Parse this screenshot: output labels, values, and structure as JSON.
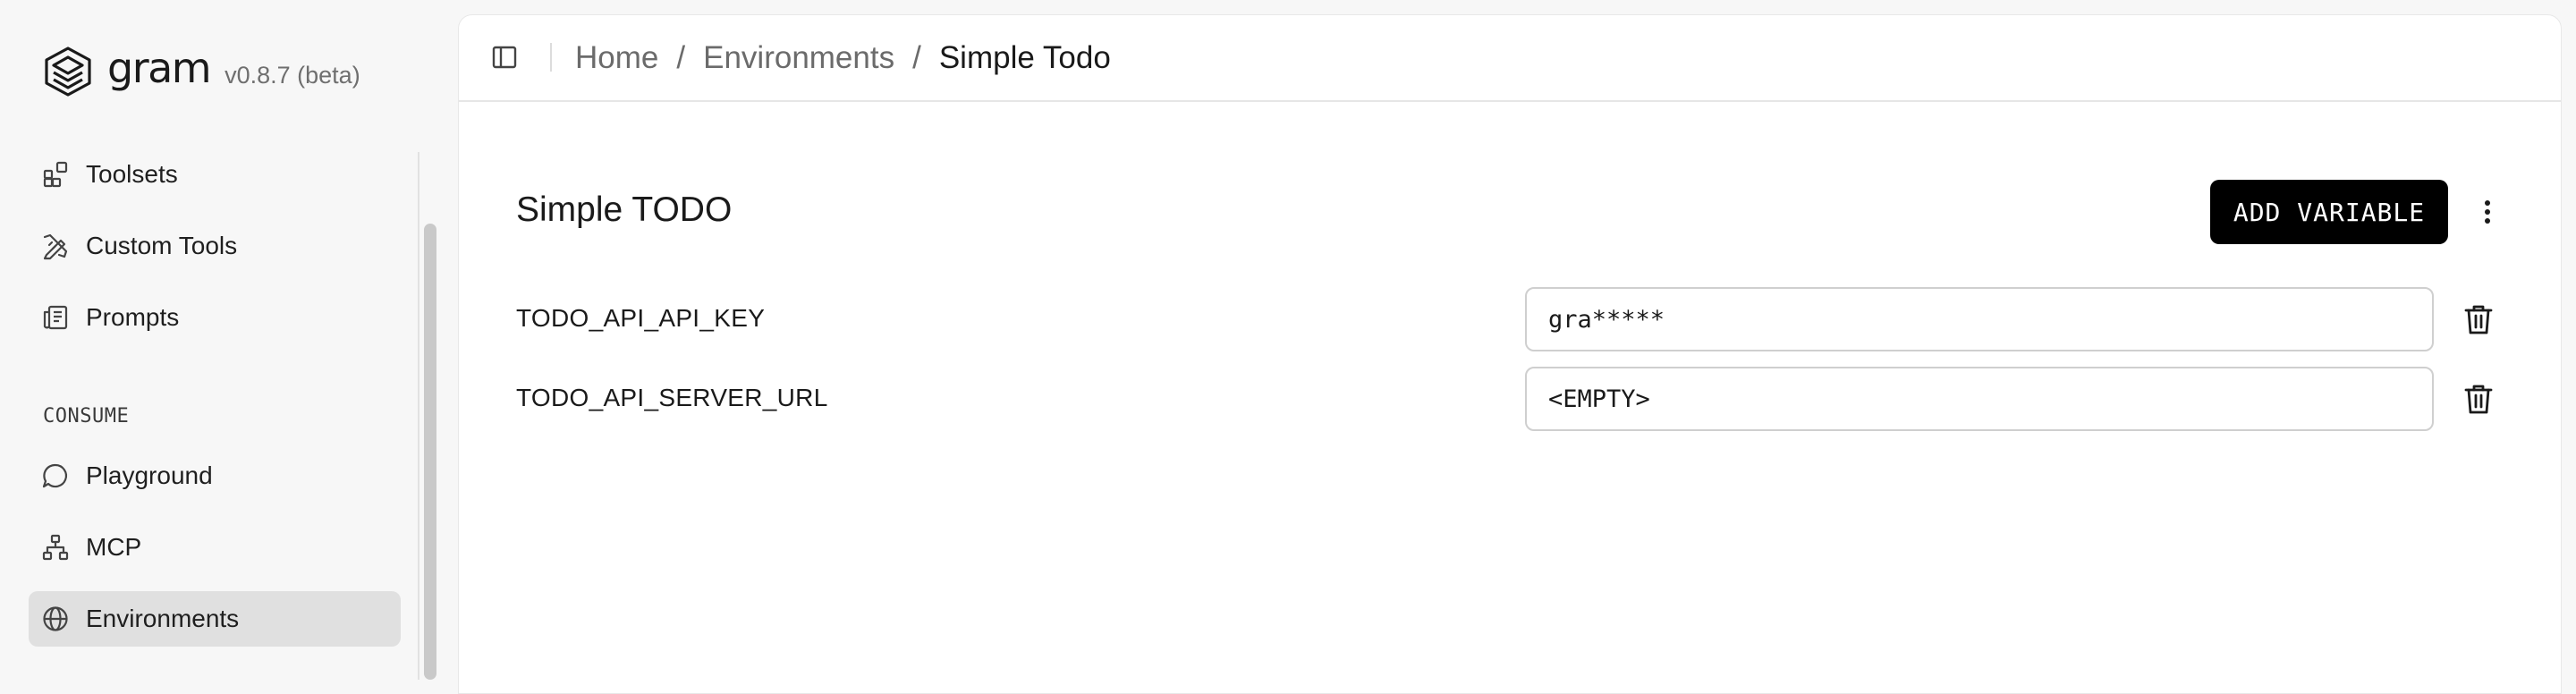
{
  "brand": {
    "name": "gram",
    "version": "v0.8.7 (beta)"
  },
  "sidebar": {
    "items": [
      {
        "label": "Toolsets",
        "icon": "toolsets-icon"
      },
      {
        "label": "Custom Tools",
        "icon": "custom-tools-icon"
      },
      {
        "label": "Prompts",
        "icon": "prompts-icon"
      }
    ],
    "section_label": "CONSUME",
    "consume_items": [
      {
        "label": "Playground",
        "icon": "chat-bubble-icon"
      },
      {
        "label": "MCP",
        "icon": "network-icon"
      },
      {
        "label": "Environments",
        "icon": "globe-icon",
        "active": true
      }
    ]
  },
  "breadcrumb": {
    "home": "Home",
    "environments": "Environments",
    "current": "Simple Todo",
    "separator": "/"
  },
  "page": {
    "title": "Simple TODO",
    "add_button": "ADD VARIABLE"
  },
  "variables": [
    {
      "name": "TODO_API_API_KEY",
      "value": "gra*****"
    },
    {
      "name": "TODO_API_SERVER_URL",
      "value": "<EMPTY>"
    }
  ],
  "colors": {
    "accent": "#000000",
    "active_nav_bg": "#e0e0e0",
    "page_bg": "#f7f7f7"
  }
}
